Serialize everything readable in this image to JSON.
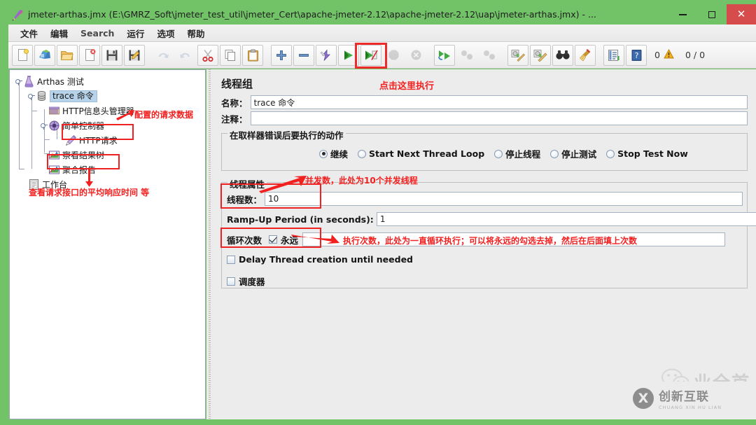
{
  "window": {
    "title": "jmeter-arthas.jmx (E:\\GMRZ_Soft\\jmeter_test_util\\jmeter_Cert\\apache-jmeter-2.12\\apache-jmeter-2.12\\uap\\jmeter-arthas.jmx) - ...",
    "title_icon": "jmeter-feather-icon",
    "minimize": "–",
    "maximize": "□",
    "close": "✕",
    "accent_green": "#72c268",
    "close_red": "#d64b4b"
  },
  "menu": {
    "items": [
      {
        "label": "文件",
        "name": "menu-file"
      },
      {
        "label": "编辑",
        "name": "menu-edit"
      },
      {
        "label": "Search",
        "name": "menu-search"
      },
      {
        "label": "运行",
        "name": "menu-run"
      },
      {
        "label": "选项",
        "name": "menu-options"
      },
      {
        "label": "帮助",
        "name": "menu-help"
      }
    ]
  },
  "toolbar": {
    "buttons": [
      {
        "name": "new-icon",
        "glyph": "new"
      },
      {
        "name": "templates-icon",
        "glyph": "templates"
      },
      {
        "name": "open-icon",
        "glyph": "open"
      },
      {
        "name": "close-icon",
        "glyph": "closedoc"
      },
      {
        "name": "save-icon",
        "glyph": "save"
      },
      {
        "name": "save-as-icon",
        "glyph": "saveas"
      },
      {
        "name": "undo-icon",
        "glyph": "undo",
        "disabled": true
      },
      {
        "name": "redo-icon",
        "glyph": "redo",
        "disabled": true
      },
      {
        "name": "cut-icon",
        "glyph": "cut"
      },
      {
        "name": "copy-icon",
        "glyph": "copy"
      },
      {
        "name": "paste-icon",
        "glyph": "paste"
      },
      {
        "name": "expand-icon",
        "glyph": "plus"
      },
      {
        "name": "collapse-icon",
        "glyph": "minus"
      },
      {
        "name": "toggle-icon",
        "glyph": "toggle"
      },
      {
        "name": "start-icon",
        "glyph": "start"
      },
      {
        "name": "start-no-pause-icon",
        "glyph": "startnopause"
      },
      {
        "name": "stop-icon",
        "glyph": "stop",
        "disabled": true
      },
      {
        "name": "shutdown-icon",
        "glyph": "shutdown",
        "disabled": true
      },
      {
        "name": "remote-start-icon",
        "glyph": "remotestart"
      },
      {
        "name": "remote-stop-icon",
        "glyph": "remotestop",
        "disabled": true
      },
      {
        "name": "remote-shutdown-icon",
        "glyph": "remoteshutdown",
        "disabled": true
      },
      {
        "name": "clear-icon",
        "glyph": "clear"
      },
      {
        "name": "clear-all-icon",
        "glyph": "clearall"
      },
      {
        "name": "search-icon",
        "glyph": "binoculars"
      },
      {
        "name": "search-reset-icon",
        "glyph": "broom"
      },
      {
        "name": "function-helper-icon",
        "glyph": "functions"
      },
      {
        "name": "help-icon",
        "glyph": "help"
      }
    ],
    "warning_count": "0",
    "warning_icon": "warning-triangle-icon",
    "thread_counter": "0 / 0"
  },
  "tree": {
    "nodes": [
      {
        "label": "Arthas 测试",
        "icon": "test-plan-icon",
        "name": "tree-node-test-plan",
        "selected": false
      },
      {
        "label": "trace 命令",
        "icon": "thread-group-icon",
        "name": "tree-node-thread-group",
        "selected": true
      },
      {
        "label": "HTTP信息头管理器",
        "icon": "header-manager-icon",
        "name": "tree-node-header-manager",
        "selected": false
      },
      {
        "label": "简单控制器",
        "icon": "simple-controller-icon",
        "name": "tree-node-simple-controller",
        "selected": false
      },
      {
        "label": "HTTP请求",
        "icon": "http-request-icon",
        "name": "tree-node-http-request",
        "selected": false
      },
      {
        "label": "察看结果树",
        "icon": "view-results-tree-icon",
        "name": "tree-node-view-results-tree",
        "selected": false
      },
      {
        "label": "聚合报告",
        "icon": "aggregate-report-icon",
        "name": "tree-node-aggregate-report",
        "selected": false
      },
      {
        "label": "工作台",
        "icon": "workbench-icon",
        "name": "tree-node-workbench",
        "selected": false
      }
    ]
  },
  "annotations": {
    "run_here": "点击这里执行",
    "request_data": "配置的请求数据",
    "avg_response": "查看请求接口的平均响应时间 等",
    "concurrency": "并发数，此处为10个并发线程",
    "loop_count": "执行次数，此处为一直循环执行；可以将永远的勾选去掉，然后在后面填上次数",
    "color": "#f32020"
  },
  "panel": {
    "title": "线程组",
    "name_label": "名称：",
    "name_value": "trace 命令",
    "comment_label": "注释：",
    "comment_value": "",
    "error_action": {
      "group_title": "在取样器错误后要执行的动作",
      "options": [
        {
          "label": "继续",
          "selected": true,
          "name": "radio-continue"
        },
        {
          "label": "Start Next Thread Loop",
          "selected": false,
          "name": "radio-start-next-thread-loop"
        },
        {
          "label": "停止线程",
          "selected": false,
          "name": "radio-stop-thread"
        },
        {
          "label": "停止测试",
          "selected": false,
          "name": "radio-stop-test"
        },
        {
          "label": "Stop Test Now",
          "selected": false,
          "name": "radio-stop-test-now"
        }
      ]
    },
    "thread_props": {
      "group_title": "线程属性",
      "threads_label": "线程数：",
      "threads_value": "10",
      "rampup_label": "Ramp-Up Period (in seconds):",
      "rampup_value": "1",
      "loop_label": "循环次数",
      "forever_label": "永远",
      "forever_checked": true,
      "loop_value": "",
      "delay_label": "Delay Thread creation until needed",
      "delay_checked": false,
      "scheduler_label": "调度器",
      "scheduler_checked": false
    }
  },
  "watermark": {
    "text": "业全首",
    "wechat_icon": "wechat-icon",
    "logo_mark": "X",
    "logo_cn": "创新互联",
    "logo_en": "CHUANG XIN HU LIAN"
  }
}
